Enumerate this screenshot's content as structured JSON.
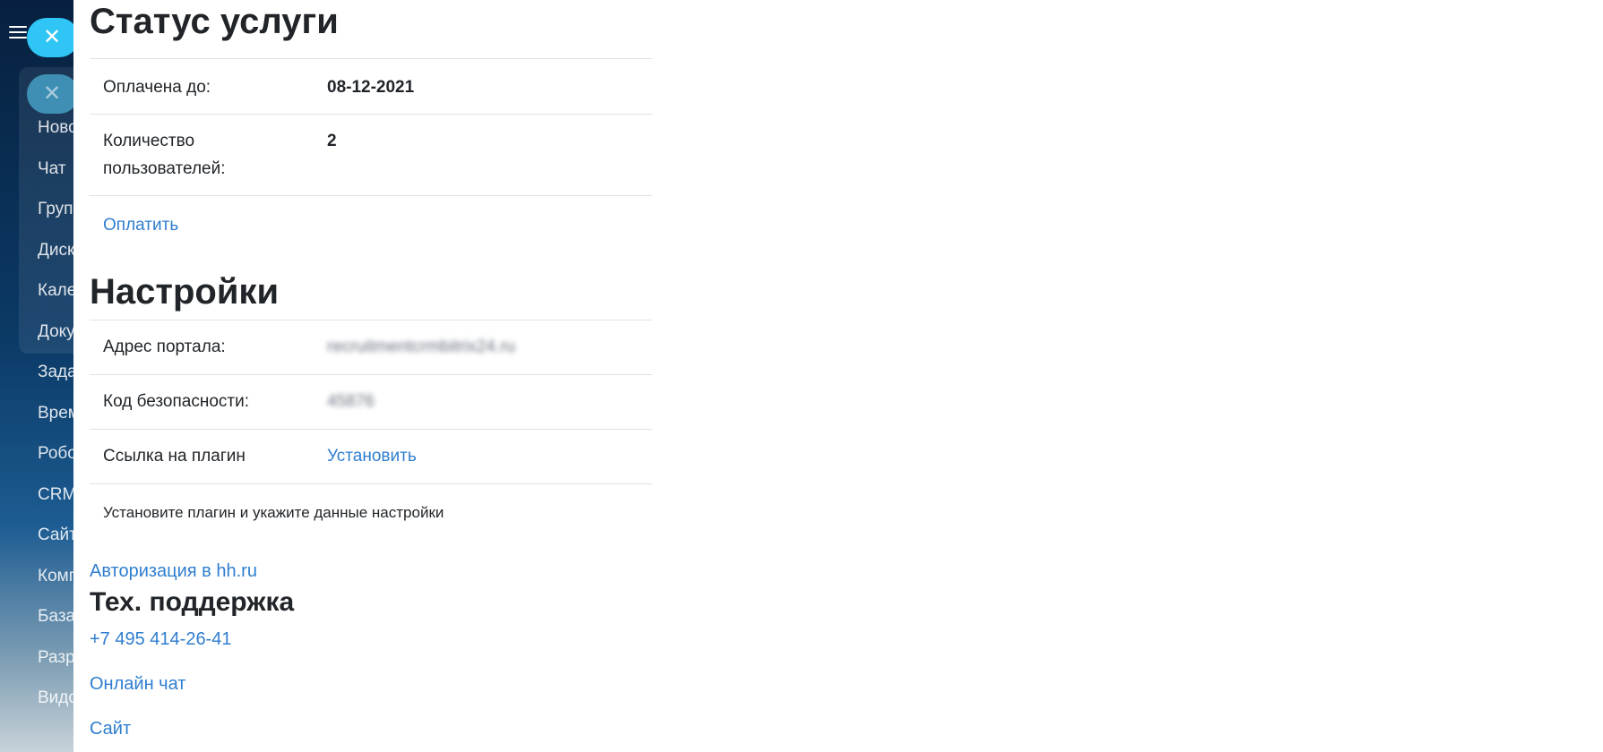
{
  "sidebar": {
    "close_glyph": "✕",
    "menu_items": [
      "Ново",
      "Чат",
      "Груп",
      "Диск",
      "Кале",
      "Доку",
      "Зада",
      "Врем",
      "Робо",
      "CRM",
      "Сайт",
      "Комп",
      "База",
      "Разр",
      "Видо"
    ]
  },
  "service_status": {
    "title": "Статус услуги",
    "rows": [
      {
        "label": "Оплачена до:",
        "value": "08-12-2021"
      },
      {
        "label": "Количество пользователей:",
        "value": "2"
      }
    ],
    "pay_link": "Оплатить"
  },
  "settings": {
    "title": "Настройки",
    "portal_address_label": "Адрес портала:",
    "portal_address_value": "recruitmentcrmbitrix24.ru",
    "security_code_label": "Код безопасности:",
    "security_code_value": "45876",
    "plugin_link_label": "Ссылка на плагин",
    "plugin_install_link": "Установить",
    "note": "Установите плагин и укажите данные настройки"
  },
  "auth_link": "Авторизация в hh.ru",
  "support": {
    "title": "Тех. поддержка",
    "phone": "+7 495 414-26-41",
    "chat": "Онлайн чат",
    "site": "Сайт"
  },
  "colors": {
    "link": "#2f7ecf",
    "close_button": "#2fc6f6",
    "text": "#212529",
    "border": "#dee2e6"
  }
}
